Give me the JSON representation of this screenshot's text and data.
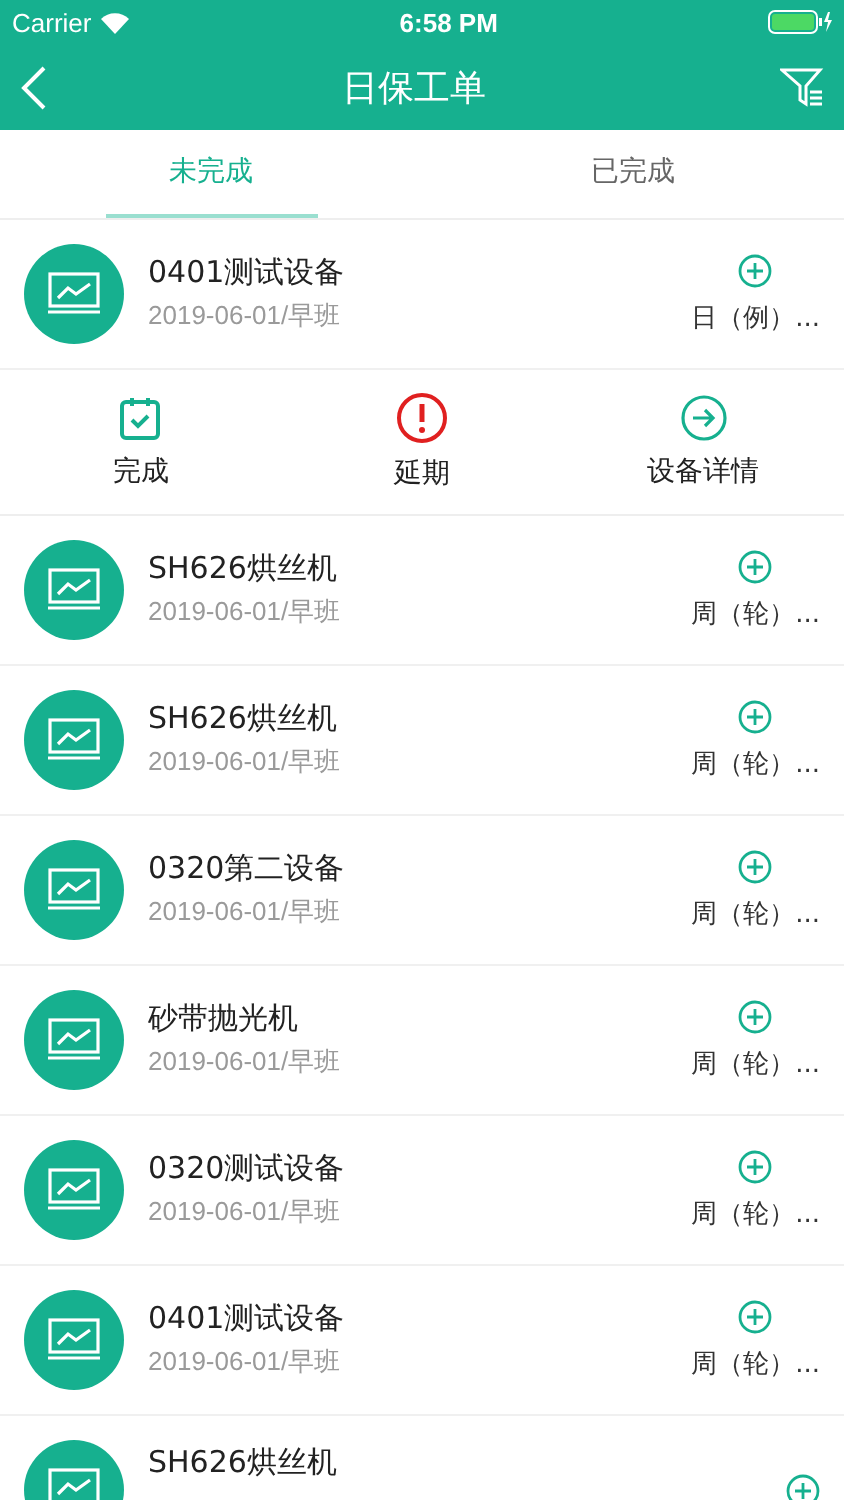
{
  "status_bar": {
    "carrier": "Carrier",
    "time": "6:58 PM"
  },
  "nav": {
    "title": "日保工单"
  },
  "tabs": [
    {
      "label": "未完成",
      "selected": true
    },
    {
      "label": "已完成",
      "selected": false
    }
  ],
  "orders": [
    {
      "name": "0401测试设备",
      "date": "2019-06-01/早班",
      "type": "日（例）...",
      "actions": [
        {
          "kind": "complete",
          "label": "完成"
        },
        {
          "kind": "postpone",
          "label": "延期"
        },
        {
          "kind": "details",
          "label": "设备详情"
        }
      ]
    },
    {
      "name": "SH626烘丝机",
      "date": "2019-06-01/早班",
      "type": "周（轮）..."
    },
    {
      "name": "SH626烘丝机",
      "date": "2019-06-01/早班",
      "type": "周（轮）..."
    },
    {
      "name": "0320第二设备",
      "date": "2019-06-01/早班",
      "type": "周（轮）..."
    },
    {
      "name": "砂带抛光机",
      "date": "2019-06-01/早班",
      "type": "周（轮）..."
    },
    {
      "name": "0320测试设备",
      "date": "2019-06-01/早班",
      "type": "周（轮）..."
    },
    {
      "name": "0401测试设备",
      "date": "2019-06-01/早班",
      "type": "周（轮）..."
    },
    {
      "name": "SH626烘丝机"
    }
  ]
}
